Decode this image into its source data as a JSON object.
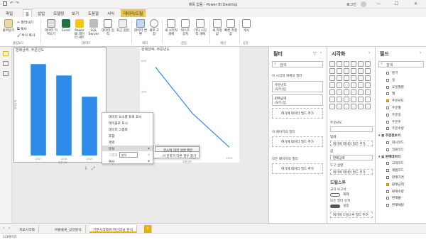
{
  "window": {
    "title": "제목 없음 - Power BI Desktop",
    "user": "로그인",
    "min": "—",
    "max": "☐",
    "close": "✕"
  },
  "ribbon_tabs": [
    "파일",
    "홈",
    "삽입",
    "모델링",
    "보기",
    "도움말",
    "서식",
    "데이터/드릴"
  ],
  "ribbon": {
    "paste": "붙여넣기",
    "cut": "잘라내기",
    "copy": "복사",
    "format_painter": "서식 복사",
    "get_data": "데이터 가져오기",
    "excel": "Excel",
    "pbi_dataset": "Power BI 데이터 세트",
    "sql_server": "SQL Server",
    "enter_data": "데이터 입력",
    "recent_sources": "최근 원본",
    "transform": "데이터 변환",
    "refresh": "새로 고침",
    "new_visual": "새 시각적 개체",
    "text_box": "텍스트 상자",
    "more_visuals": "기타 시각적 개체",
    "new_measure": "새 측정값",
    "quick_measure": "빠른 측정값",
    "publish": "게시",
    "groups": {
      "clipboard": "클립보드",
      "data": "데이터",
      "query": "쿼리",
      "insert": "삽입",
      "calc": "계산",
      "share": "공유"
    }
  },
  "canvas": {
    "bar_visual_title": "판매금액, 주문년도",
    "bar_x_label": "주문년도",
    "bar_y_label": "판매금액",
    "line_visual_title": "판매금액, 주문년도",
    "line_x_label": "주문년도",
    "line_y_label": "판매금액",
    "bar_ticks": [
      "2017",
      "2018",
      "2019"
    ],
    "line_ticks": [
      "2017",
      "2018",
      "2019"
    ],
    "y_ticks": [
      "60억",
      "40억",
      "20억",
      "0억"
    ]
  },
  "chart_data": [
    {
      "type": "bar",
      "title": "판매금액, 주문년도",
      "xlabel": "주문년도",
      "ylabel": "판매금액",
      "categories": [
        "2017",
        "2018",
        "2019"
      ],
      "values": [
        5.6,
        4.9,
        3.6
      ],
      "ylim": [
        0,
        6
      ],
      "colors": [
        "#2f8bea"
      ]
    },
    {
      "type": "line",
      "title": "판매금액, 주문년도",
      "xlabel": "주문년도",
      "ylabel": "판매금액",
      "categories": [
        "2017",
        "2018",
        "2019"
      ],
      "values": [
        56,
        26,
        4
      ],
      "ylim": [
        0,
        60
      ],
      "colors": [
        "#2f8bea"
      ]
    }
  ],
  "context_menu": {
    "items": [
      "데이터 요소를 표로 표시",
      "테이블로 표시",
      "데이터 그룹화",
      "포함",
      "제외",
      "분석",
      "그룹화",
      "복사"
    ],
    "highlighted": "분석",
    "submenu": [
      "감소에 대한 설명 확인",
      "이 분포가 다른 경우 찾기"
    ],
    "tooltip": "분석"
  },
  "filters": {
    "title": "필터",
    "search": "검색",
    "on_visual": "이 시각적 개체의 필터",
    "field1": "주문년도\n(모두)임",
    "field2": "판매금액\n(모두)임",
    "add_field": "여기에 데이터 필드 추가",
    "on_page": "이 페이지의 필터",
    "on_all": "모든 페이지의 필터"
  },
  "viz": {
    "title": "시각화",
    "fields": [
      "주문년도",
      "범례",
      "값",
      "판매금액",
      "도구 설명",
      "드릴스루"
    ],
    "drill": "드릴스루",
    "cross_report": "교차 보고서",
    "keep_filters": "모든 필터 유지",
    "off": "해제",
    "on": "설정",
    "add_drill": "여기에 드릴스루 필드 추가",
    "add_data": "여기에 데이터 필드 추가"
  },
  "fields": {
    "title": "필드",
    "search": "검색",
    "items": [
      "분기",
      "일",
      "요일월명",
      "월",
      "주문년도",
      "주문월",
      "주문일",
      "주문주",
      "주문수량",
      "주문정보서",
      "회사코드",
      "직원코드",
      "판매데이터",
      "고객코드",
      "제품코드",
      "판매가격",
      "판매금액",
      "판매수량",
      "판매율",
      "판매채널"
    ],
    "checked": [
      "주문년도",
      "판매금액"
    ]
  },
  "page_tabs": [
    "지도시각화",
    "버블플롯_상관분석",
    "기본시각화와 머신러닝 분석",
    "+"
  ],
  "status": "1/3페이지"
}
